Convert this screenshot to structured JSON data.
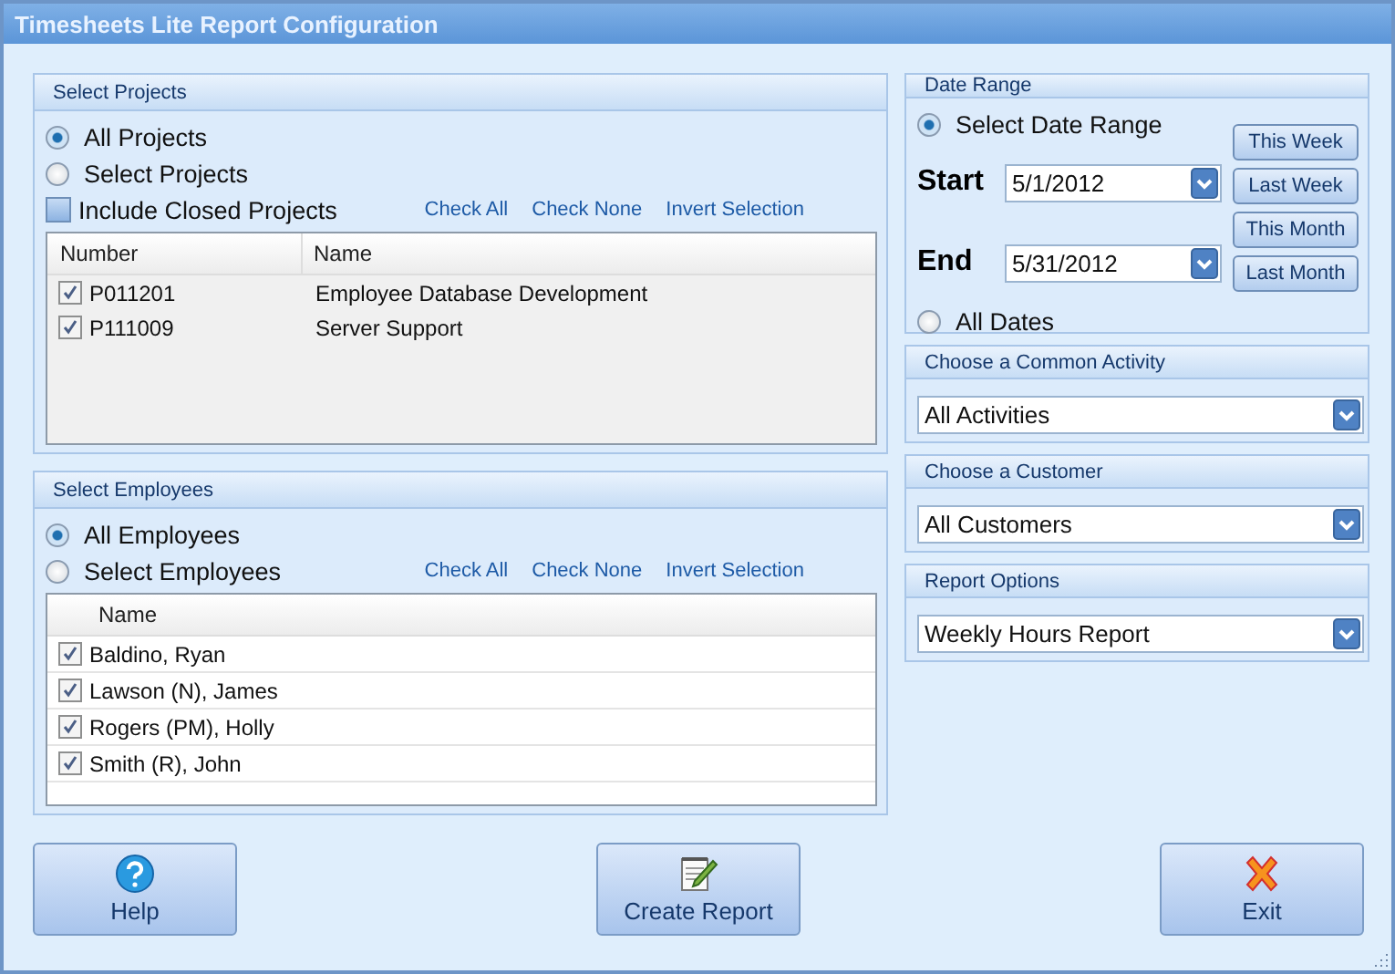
{
  "window": {
    "title": "Timesheets Lite Report Configuration"
  },
  "projects": {
    "title": "Select Projects",
    "options": [
      {
        "label": "All Projects",
        "selected": true
      },
      {
        "label": "Select Projects",
        "selected": false
      }
    ],
    "include_closed": {
      "label": "Include Closed Projects",
      "checked": false
    },
    "links": [
      "Check All",
      "Check None",
      "Invert Selection"
    ],
    "columns": [
      "Number",
      "Name"
    ],
    "rows": [
      {
        "number": "P011201",
        "name": "Employee Database Development",
        "checked": true
      },
      {
        "number": "P111009",
        "name": "Server Support",
        "checked": true
      }
    ]
  },
  "employees": {
    "title": "Select Employees",
    "options": [
      {
        "label": "All Employees",
        "selected": true
      },
      {
        "label": "Select Employees",
        "selected": false
      }
    ],
    "links": [
      "Check All",
      "Check None",
      "Invert Selection"
    ],
    "columns": [
      "Name"
    ],
    "rows": [
      {
        "name": "Baldino, Ryan",
        "checked": true
      },
      {
        "name": "Lawson (N), James",
        "checked": true
      },
      {
        "name": "Rogers (PM), Holly",
        "checked": true
      },
      {
        "name": "Smith (R), John",
        "checked": true
      }
    ]
  },
  "date_range": {
    "title": "Date Range",
    "options": [
      {
        "label": "Select Date Range",
        "selected": true
      },
      {
        "label": "All Dates",
        "selected": false
      }
    ],
    "start": {
      "label": "Start",
      "value": "5/1/2012"
    },
    "end": {
      "label": "End",
      "value": "5/31/2012"
    },
    "quick_buttons": [
      "This Week",
      "Last Week",
      "This Month",
      "Last Month"
    ]
  },
  "selectors": [
    {
      "title": "Choose a Common Activity",
      "value": "All Activities"
    },
    {
      "title": "Choose a Customer",
      "value": "All Customers"
    },
    {
      "title": "Report Options",
      "value": "Weekly Hours Report"
    }
  ],
  "buttons": [
    {
      "kind": "help",
      "label": "Help"
    },
    {
      "kind": "create",
      "label": "Create Report"
    },
    {
      "kind": "exit",
      "label": "Exit"
    }
  ]
}
